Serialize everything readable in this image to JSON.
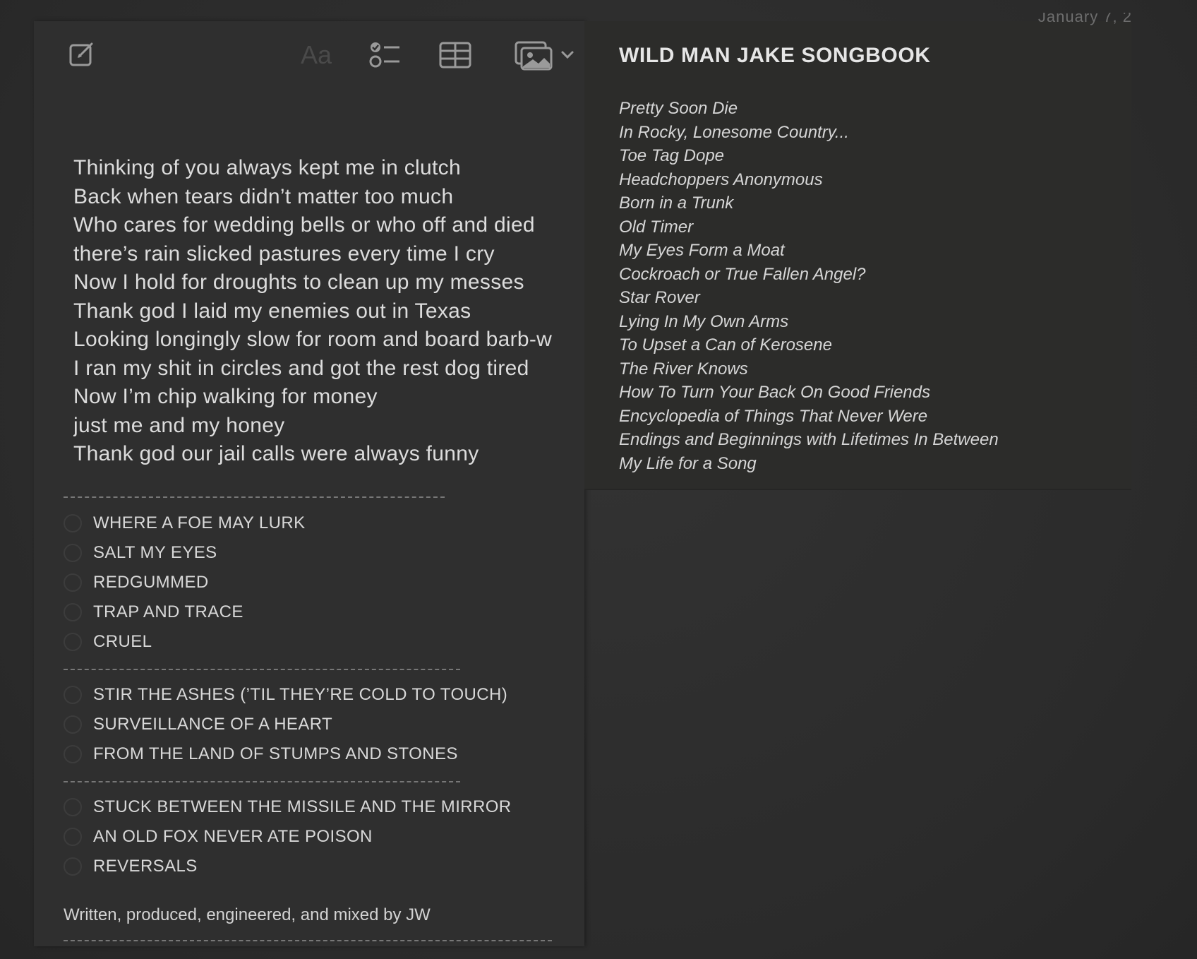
{
  "header": {
    "date_fragment": "January 7, 2"
  },
  "toolbar": {
    "compose_icon": "compose-icon",
    "format_label": "Aa",
    "checklist_icon": "checklist-icon",
    "table_icon": "table-icon",
    "media_icon": "photo-icon",
    "chevron_icon": "chevron-down-icon"
  },
  "note": {
    "lyrics": [
      "Thinking of you always kept me in clutch",
      "Back when tears didn’t matter too much",
      "Who cares for wedding bells or who off and died",
      "there’s rain slicked pastures every time I cry",
      "Now I hold for droughts to clean up my messes",
      "Thank god I laid my enemies out in Texas",
      "Looking longingly slow for room and board barb-w",
      "I ran my shit in circles and got the rest dog tired",
      "Now I’m chip walking for money",
      "just me and my honey",
      "Thank god our jail calls were always funny"
    ],
    "checklist_groups": [
      [
        "WHERE A FOE MAY LURK",
        "SALT MY EYES",
        "REDGUMMED",
        "TRAP AND TRACE",
        "CRUEL"
      ],
      [
        "STIR THE ASHES (’TIL THEY’RE COLD TO TOUCH)",
        "SURVEILLANCE OF A HEART",
        "FROM THE LAND OF STUMPS AND STONES"
      ],
      [
        "STUCK BETWEEN THE MISSILE AND THE MIRROR",
        "AN OLD FOX NEVER ATE POISON",
        "REVERSALS"
      ]
    ],
    "credit": "Written, produced, engineered, and mixed by JW"
  },
  "songbook": {
    "title": "WILD MAN JAKE SONGBOOK",
    "songs": [
      "Pretty Soon Die",
      "In Rocky, Lonesome Country...",
      "Toe Tag Dope",
      "Headchoppers Anonymous",
      "Born in a Trunk",
      "Old Timer",
      "My Eyes Form a Moat",
      "Cockroach or True Fallen Angel?",
      "Star Rover",
      "Lying In My Own Arms",
      "To Upset a Can of Kerosene",
      "The River Knows",
      "How To Turn Your Back On Good Friends",
      "Encyclopedia of Things That Never Were",
      "Endings and Beginnings with Lifetimes In Between",
      "My Life for a Song"
    ]
  }
}
